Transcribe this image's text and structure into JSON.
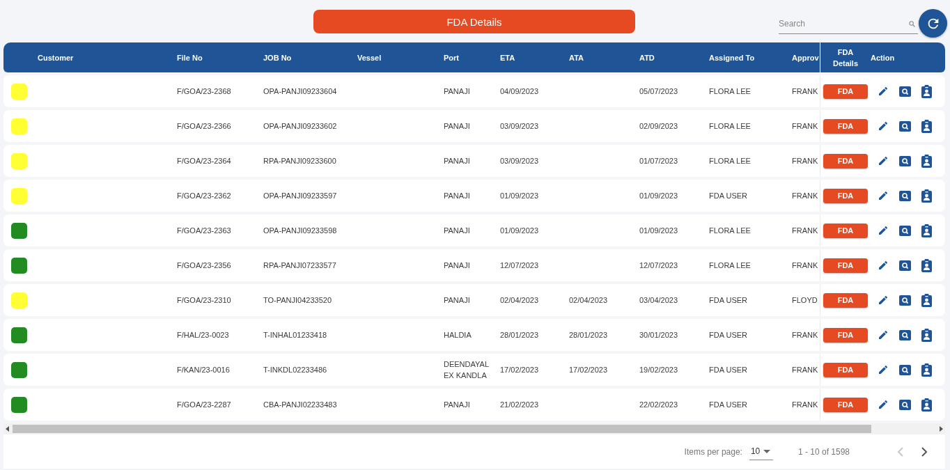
{
  "title_button": "FDA Details",
  "search": {
    "placeholder": "Search"
  },
  "table": {
    "columns": [
      "Customer",
      "File No",
      "JOB No",
      "Vessel",
      "Port",
      "ETA",
      "ATA",
      "ATD",
      "Assigned To",
      "Approv",
      "FDA Details",
      "Action"
    ],
    "rows": [
      {
        "color": "#ffff33",
        "file_no": "F/GOA/23-2368",
        "job_no": "OPA-PANJI09233604",
        "port": "PANAJI",
        "eta": "04/09/2023",
        "ata": "",
        "atd": "05/07/2023",
        "assigned_to": "FLORA LEE",
        "approv": "FRANK",
        "fda": "FDA"
      },
      {
        "color": "#ffff33",
        "file_no": "F/GOA/23-2366",
        "job_no": "OPA-PANJI09233602",
        "port": "PANAJI",
        "eta": "03/09/2023",
        "ata": "",
        "atd": "02/09/2023",
        "assigned_to": "FLORA LEE",
        "approv": "FRANK",
        "fda": "FDA"
      },
      {
        "color": "#ffff33",
        "file_no": "F/GOA/23-2364",
        "job_no": "RPA-PANJI09233600",
        "port": "PANAJI",
        "eta": "03/09/2023",
        "ata": "",
        "atd": "01/07/2023",
        "assigned_to": "FLORA LEE",
        "approv": "FRANK",
        "fda": "FDA"
      },
      {
        "color": "#ffff33",
        "file_no": "F/GOA/23-2362",
        "job_no": "OPA-PANJI09233597",
        "port": "PANAJI",
        "eta": "01/09/2023",
        "ata": "",
        "atd": "01/09/2023",
        "assigned_to": "FDA USER",
        "approv": "FRANK",
        "fda": "FDA"
      },
      {
        "color": "#228b22",
        "file_no": "F/GOA/23-2363",
        "job_no": "OPA-PANJI09233598",
        "port": "PANAJI",
        "eta": "01/09/2023",
        "ata": "",
        "atd": "01/09/2023",
        "assigned_to": "FLORA LEE",
        "approv": "FRANK",
        "fda": "FDA"
      },
      {
        "color": "#228b22",
        "file_no": "F/GOA/23-2356",
        "job_no": "RPA-PANJI07233577",
        "port": "PANAJI",
        "eta": "12/07/2023",
        "ata": "",
        "atd": "12/07/2023",
        "assigned_to": "FLORA LEE",
        "approv": "FRANK",
        "fda": "FDA"
      },
      {
        "color": "#ffff33",
        "file_no": "F/GOA/23-2310",
        "job_no": "TO-PANJI04233520",
        "port": "PANAJI",
        "eta": "02/04/2023",
        "ata": "02/04/2023",
        "atd": "03/04/2023",
        "assigned_to": "FDA USER",
        "approv": "FLOYD",
        "fda": "FDA"
      },
      {
        "color": "#228b22",
        "file_no": "F/HAL/23-0023",
        "job_no": "T-INHAL01233418",
        "port": "HALDIA",
        "eta": "28/01/2023",
        "ata": "28/01/2023",
        "atd": "30/01/2023",
        "assigned_to": "FDA USER",
        "approv": "FRANK",
        "fda": "FDA"
      },
      {
        "color": "#228b22",
        "file_no": "F/KAN/23-0016",
        "job_no": "T-INKDL02233486",
        "port": "DEENDAYAL EX KANDLA",
        "eta": "17/02/2023",
        "ata": "17/02/2023",
        "atd": "19/02/2023",
        "assigned_to": "FDA USER",
        "approv": "FRANK",
        "fda": "FDA"
      },
      {
        "color": "#228b22",
        "file_no": "F/GOA/23-2287",
        "job_no": "CBA-PANJI02233483",
        "port": "PANAJI",
        "eta": "21/02/2023",
        "ata": "",
        "atd": "22/02/2023",
        "assigned_to": "FDA USER",
        "approv": "FRANK",
        "fda": "FDA"
      }
    ]
  },
  "paginator": {
    "label": "Items per page:",
    "page_size": "10",
    "range": "1 - 10 of 1598"
  }
}
